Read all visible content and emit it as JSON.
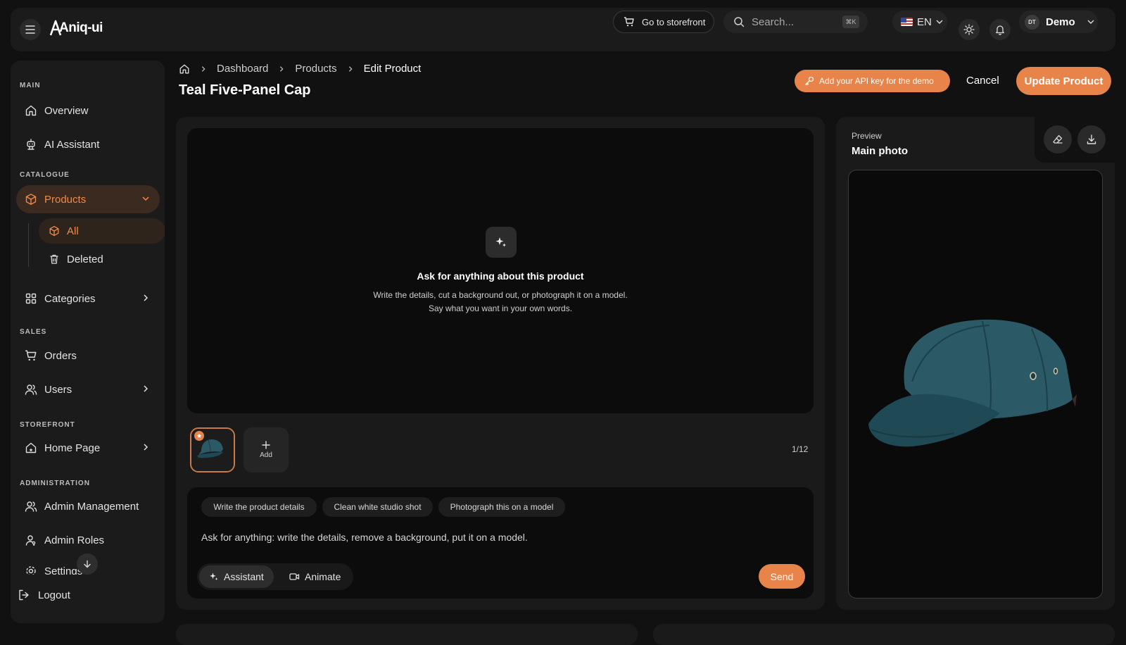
{
  "app": {
    "logo": "Aniq-ui"
  },
  "topbar": {
    "storefront_label": "Go to storefront",
    "search_placeholder": "Search...",
    "search_shortcut": "⌘K",
    "language": "EN",
    "user_initials": "DT",
    "user_name": "Demo"
  },
  "sidebar": {
    "sections": {
      "main": "MAIN",
      "catalogue": "CATALOGUE",
      "sales": "SALES",
      "storefront": "STOREFRONT",
      "administration": "ADMINISTRATION"
    },
    "items": {
      "overview": "Overview",
      "ai_assistant": "AI Assistant",
      "products": "Products",
      "all": "All",
      "deleted": "Deleted",
      "categories": "Categories",
      "orders": "Orders",
      "users": "Users",
      "home_page": "Home Page",
      "admin_management": "Admin Management",
      "admin_roles": "Admin Roles",
      "settings": "Settings"
    },
    "logout": "Logout"
  },
  "header": {
    "breadcrumb": [
      "Dashboard",
      "Products",
      "Edit Product"
    ],
    "title": "Teal Five-Panel Cap",
    "api_key_label": "Add your API key for the demo",
    "cancel_label": "Cancel",
    "update_label": "Update Product"
  },
  "assistant": {
    "empty_title": "Ask for anything about this product",
    "empty_desc": "Write the details, cut a background out, or photograph it on a model. Say what you want in your own words.",
    "add_label": "Add",
    "counter": "1/12",
    "chips": [
      "Write the product details",
      "Clean white studio shot",
      "Photograph this on a model"
    ],
    "prompt_placeholder": "Ask for anything: write the details, remove a background, put it on a model.",
    "modes": [
      "Assistant",
      "Animate"
    ],
    "send_label": "Send"
  },
  "preview": {
    "label": "Preview",
    "title": "Main photo"
  },
  "colors": {
    "accent": "#e8844a",
    "cap": "#1f4a55"
  }
}
